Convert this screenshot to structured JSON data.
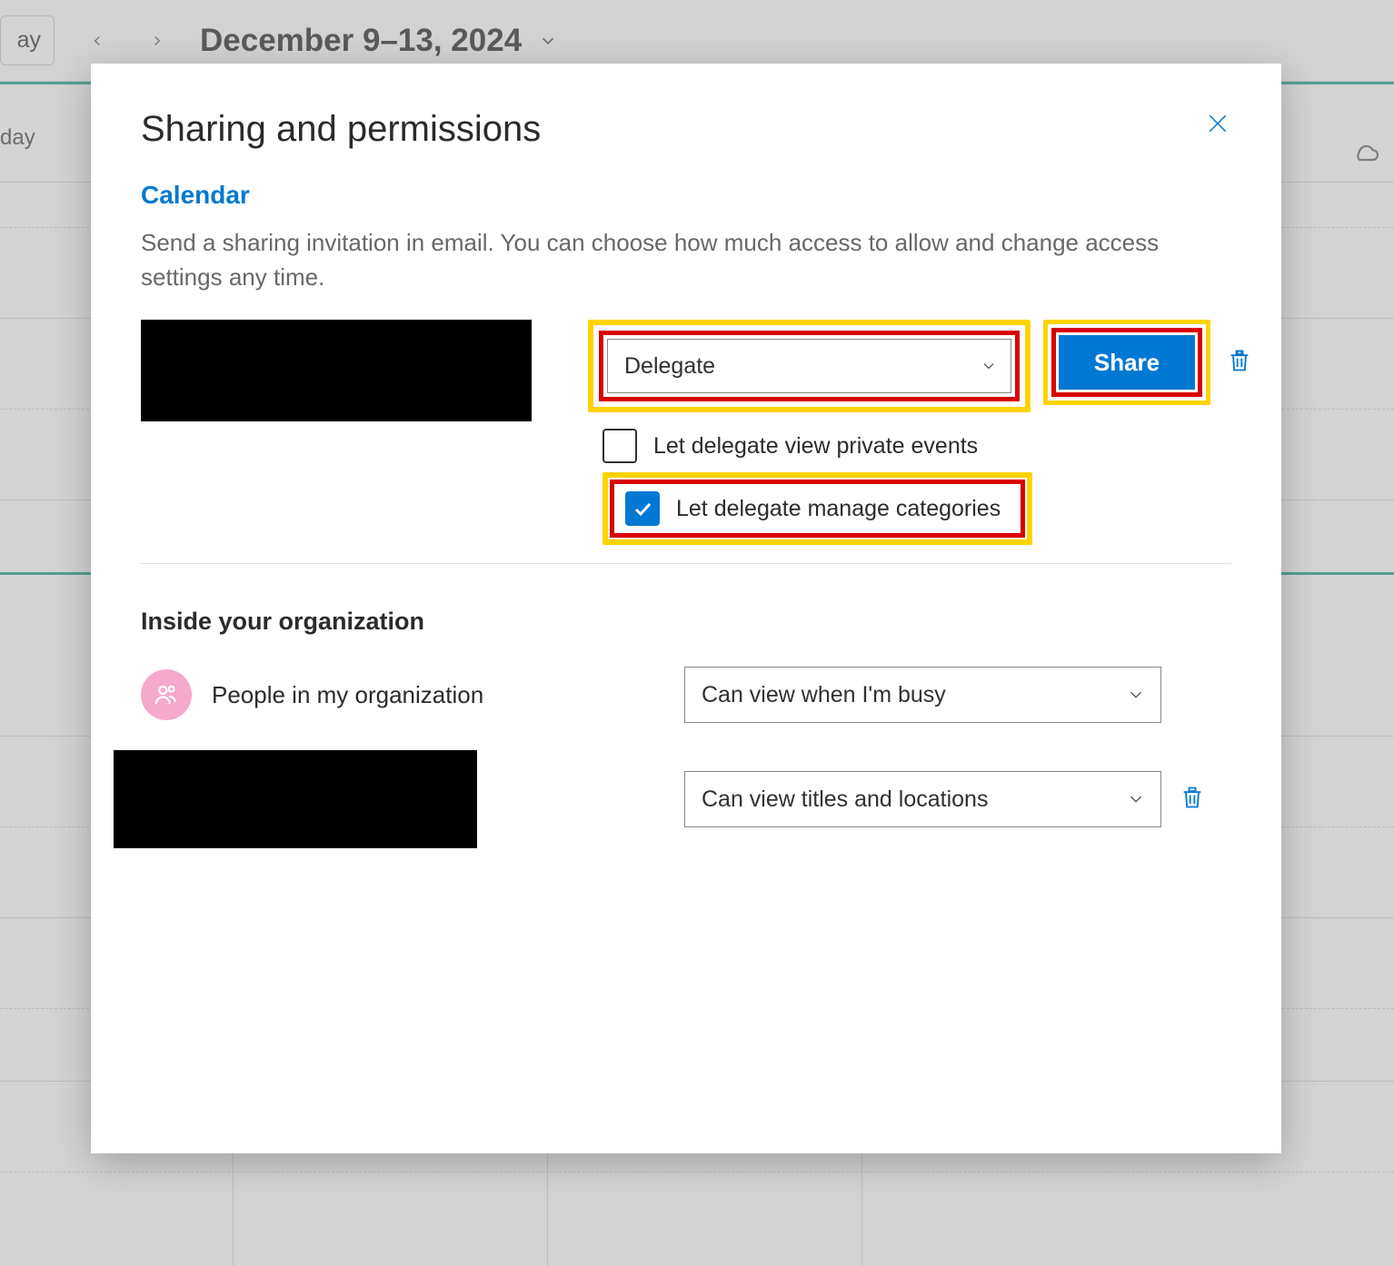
{
  "background": {
    "today_button": "ay",
    "date_range": "December 9–13, 2024",
    "day_label": "day"
  },
  "modal": {
    "title": "Sharing and permissions",
    "section_label": "Calendar",
    "description": "Send a sharing invitation in email. You can choose how much access to allow and change access settings any time.",
    "permission_select": "Delegate",
    "share_button": "Share",
    "checkbox_private": "Let delegate view private events",
    "checkbox_categories": "Let delegate manage categories",
    "org_heading": "Inside your organization",
    "org_people_label": "People in my organization",
    "org_people_permission": "Can view when I'm busy",
    "org_user_permission": "Can view titles and locations"
  }
}
